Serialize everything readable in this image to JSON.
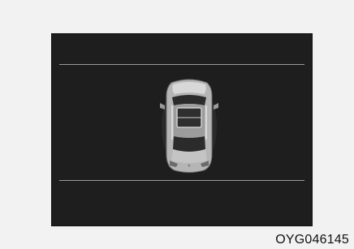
{
  "figure": {
    "code": "OYG046145"
  },
  "icons": {
    "vehicle": "car-top-view-icon"
  },
  "colors": {
    "screen_background": "#1e1e1e",
    "lane_line": "#9a9a9a",
    "car_body": "#b5b5b5",
    "page_background": "#f2f2f2"
  }
}
